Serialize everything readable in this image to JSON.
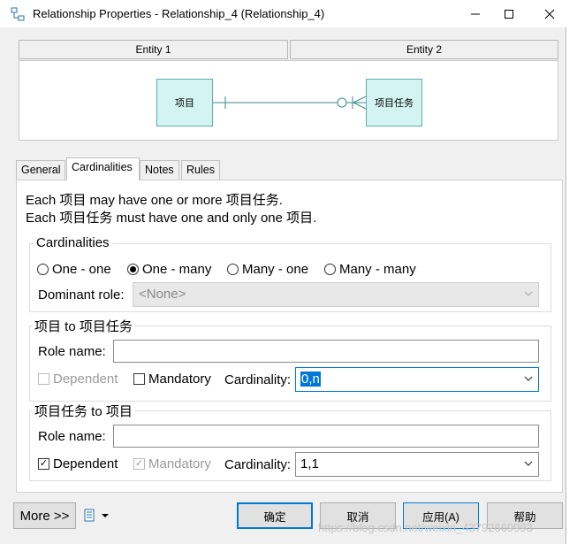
{
  "window": {
    "title": "Relationship Properties - Relationship_4 (Relationship_4)"
  },
  "diagram": {
    "entity1_header": "Entity 1",
    "entity2_header": "Entity 2",
    "entity1_name": "项目",
    "entity2_name": "项目任务"
  },
  "tabs": [
    {
      "label": "General"
    },
    {
      "label": "Cardinalities",
      "active": true
    },
    {
      "label": "Notes"
    },
    {
      "label": "Rules"
    }
  ],
  "description": {
    "line1": "Each 项目 may have one or more 项目任务.",
    "line2": "Each 项目任务 must have one and only one 项目."
  },
  "cardinalities": {
    "title": "Cardinalities",
    "options": [
      "One - one",
      "One - many",
      "Many - one",
      "Many - many"
    ],
    "selected": "One - many",
    "dominant_label": "Dominant role:",
    "dominant_value": "<None>"
  },
  "role_a": {
    "title": "项目 to 项目任务",
    "role_name_label": "Role name:",
    "role_name_value": "",
    "dependent_label": "Dependent",
    "dependent_checked": false,
    "mandatory_label": "Mandatory",
    "mandatory_checked": false,
    "cardinality_label": "Cardinality:",
    "cardinality_value": "0,n"
  },
  "role_b": {
    "title": "项目任务 to 项目",
    "role_name_label": "Role name:",
    "role_name_value": "",
    "dependent_label": "Dependent",
    "dependent_checked": true,
    "mandatory_label": "Mandatory",
    "mandatory_checked": true,
    "cardinality_label": "Cardinality:",
    "cardinality_value": "1,1"
  },
  "buttons": {
    "more": "More >>",
    "ok": "确定",
    "cancel": "取消",
    "apply": "应用(A)",
    "help": "帮助"
  },
  "watermark": "https://blog.csdn.net/weixin_43792669993",
  "colors": {
    "accent": "#0078d7",
    "entity_fill": "#d4f4f4",
    "entity_border": "#5ab0b0"
  }
}
